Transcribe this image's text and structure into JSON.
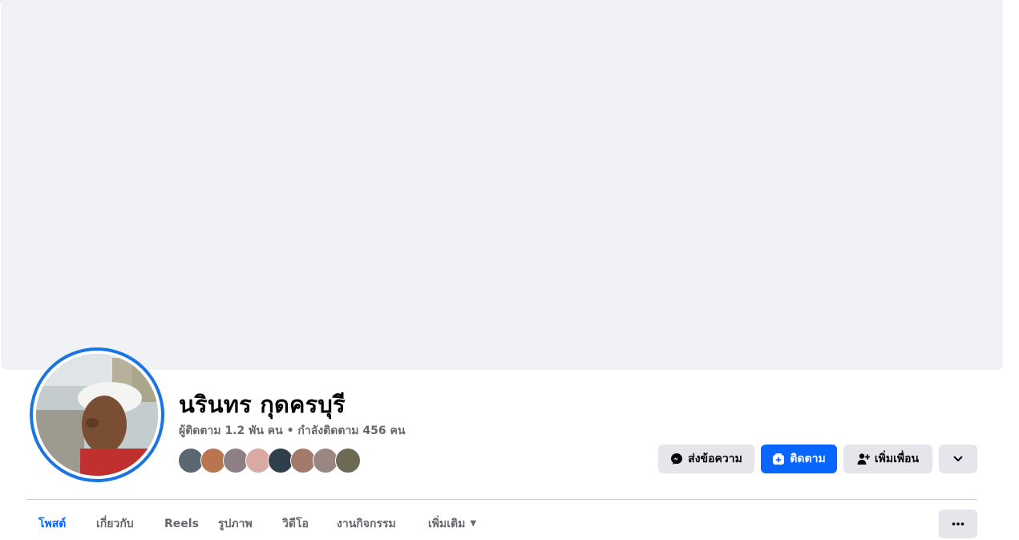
{
  "profile": {
    "name": "นรินทร กุดครบุรี",
    "followers_text": "ผู้ติดตาม 1.2 พัน คน • กำลังติดตาม 456 คน",
    "friend_avatar_colors": [
      "#5b6770",
      "#b9754f",
      "#8e7f86",
      "#d9a9a3",
      "#2e3f4a",
      "#a27a6a",
      "#9a8782",
      "#6d6a54"
    ]
  },
  "actions": {
    "message_label": "ส่งข้อความ",
    "follow_label": "ติดตาม",
    "add_friend_label": "เพิ่มเพื่อน"
  },
  "tabs": [
    {
      "label": "โพสต์"
    },
    {
      "label": "เกี่ยวกับ"
    },
    {
      "label": "Reels"
    },
    {
      "label": "รูปภาพ"
    },
    {
      "label": "วิดีโอ"
    },
    {
      "label": "งานกิจกรรม"
    },
    {
      "label": "เพิ่มเติม"
    }
  ],
  "colors": {
    "accent": "#0866ff",
    "cover_bg": "#f0f2f5",
    "button_grey": "#e4e6eb",
    "secondary_text": "#65676b"
  },
  "icons": {
    "message": "messenger-icon",
    "follow": "follow-icon",
    "add_friend": "add-friend-icon",
    "menu": "chevron-down-icon",
    "more": "ellipsis-icon",
    "tab_more": "caret-down-icon"
  }
}
